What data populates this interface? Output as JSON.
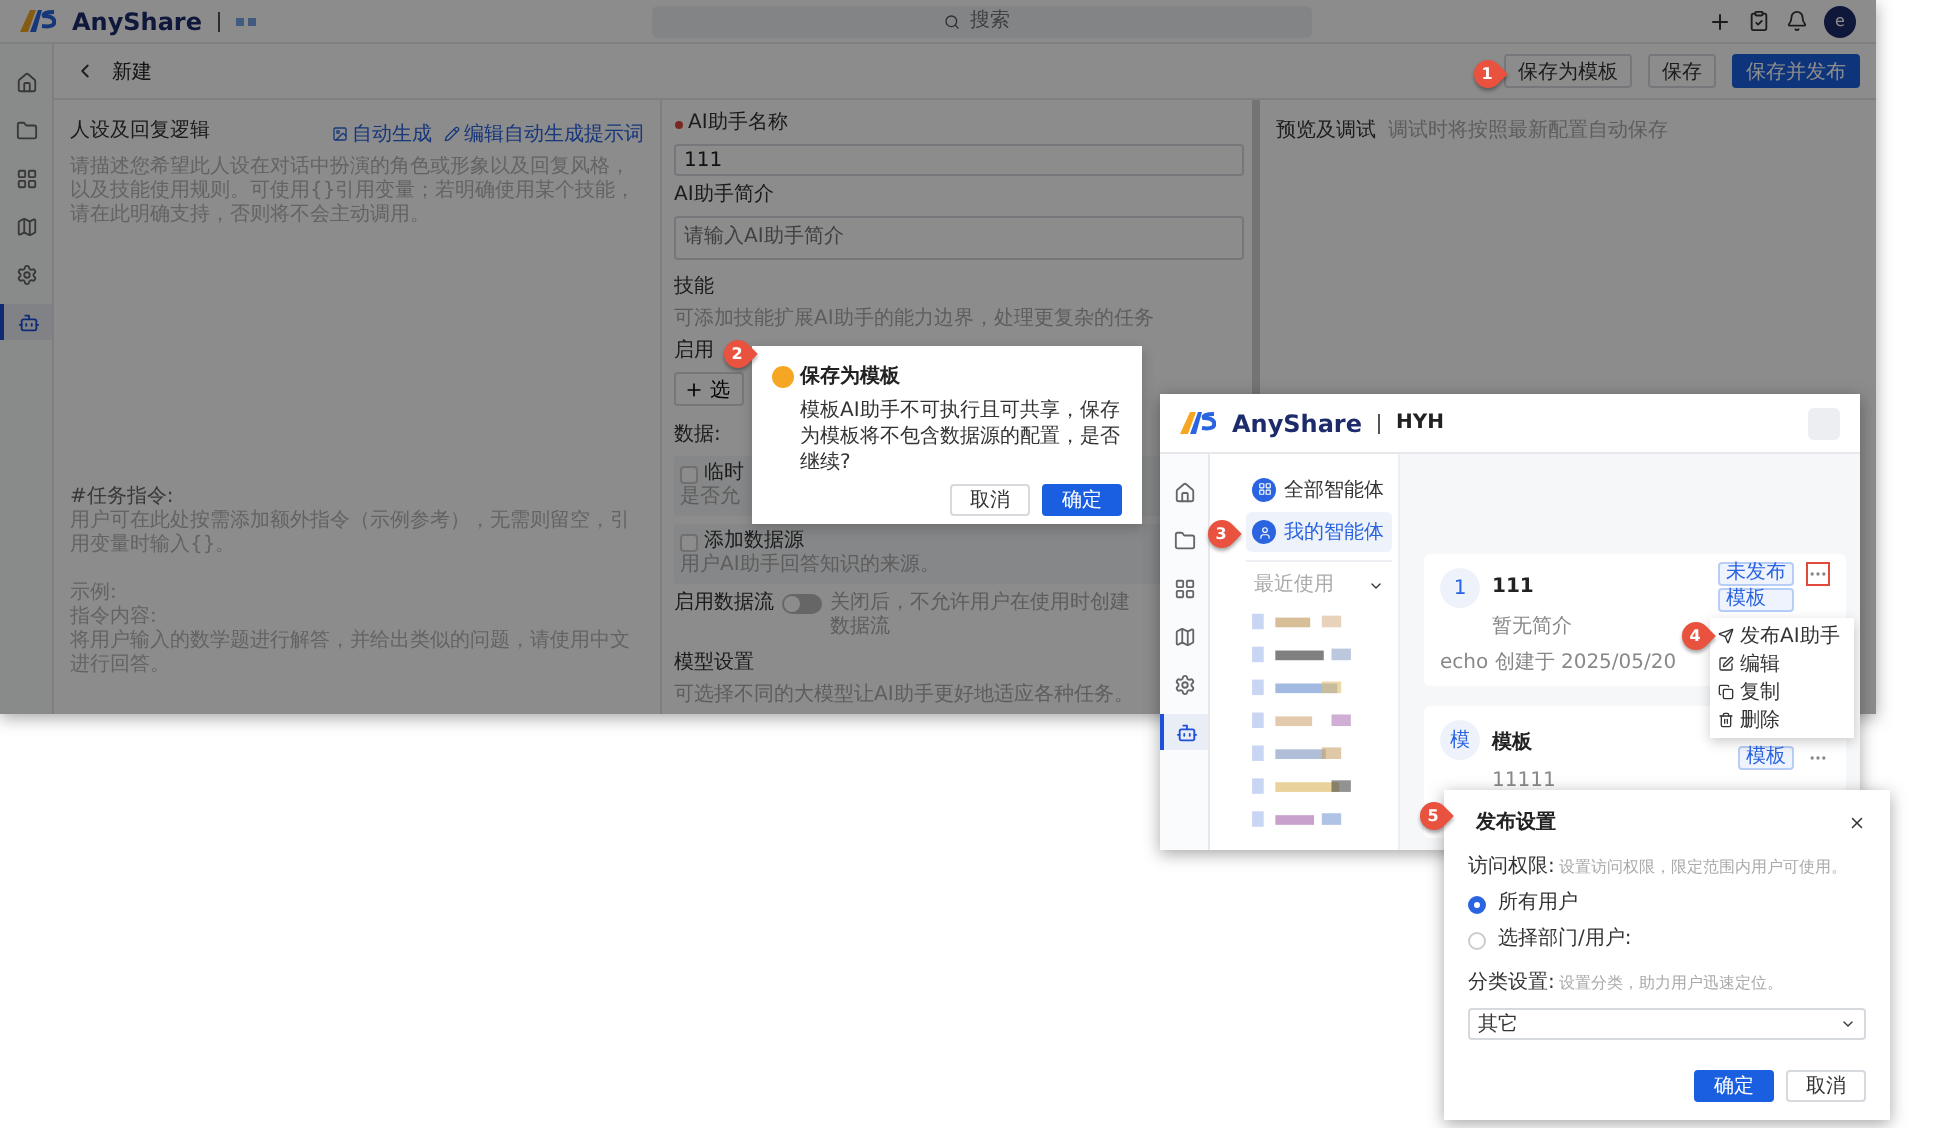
{
  "main_window": {
    "logo": "AnyShare",
    "search": {
      "placeholder": "搜索"
    },
    "avatar": "e",
    "rail": [
      {
        "selected": false
      },
      {
        "selected": false
      },
      {
        "selected": false
      },
      {
        "selected": false
      },
      {
        "selected": false
      },
      {
        "selected": true
      }
    ],
    "page_title": "新建",
    "header_buttons": [
      {
        "label": "保存为模板",
        "kind": "default"
      },
      {
        "label": "保存",
        "kind": "default"
      },
      {
        "label": "保存并发布",
        "kind": "primary"
      }
    ],
    "persona": {
      "title": "人设及回复逻辑",
      "links": [
        "自动生成",
        "编辑自动生成提示词"
      ],
      "placeholder": "请描述您希望此人设在对话中扮演的角色或形象以及回复风格，以及技能使用规则。可使用{}引用变量；若明确使用某个技能，请在此明确支持，否则将不会主动调用。",
      "instructions": [
        {
          "lines": [
            "#任务指令:",
            "用户可在此处按需添加额外指令（示例参考），无需则留空，引用变量时输入{}。"
          ]
        },
        {
          "lines": [
            "示例:",
            "指令内容:",
            "将用户输入的数学题进行解答，并给出类似的问题，请使用中文进行回答。"
          ]
        }
      ]
    },
    "form": {
      "name": {
        "label": "AI助手名称",
        "required": true,
        "value": "111"
      },
      "intro": {
        "label": "AI助手简介",
        "placeholder": "请输入AI助手简介"
      },
      "skills": {
        "title": "技能",
        "hint": "可添加技能扩展AI助手的能力边界，处理更复杂的任务",
        "enable_label": "启用",
        "add_button": "选"
      },
      "data": {
        "title": "数据:",
        "options": [
          {
            "label": "临时",
            "hint": "是否允",
            "checked": false
          },
          {
            "label": "添加数据源",
            "hint": "用户AI助手回答知识的来源。",
            "checked": false
          }
        ],
        "dataflow": {
          "label": "启用数据流",
          "on": false,
          "hint": "关闭后，不允许用户在使用时创建数据流"
        }
      },
      "model": {
        "title": "模型设置",
        "hint": "可选择不同的大模型让AI助手更好地适应各种任务。"
      }
    },
    "preview": {
      "title": "预览及调试",
      "hint": "调试时将按照最新配置自动保存"
    },
    "dialog": {
      "title": "保存为模板",
      "message": "模板AI助手不可执行且可共享，保存为模板将不包含数据源的配置，是否继续?",
      "buttons": [
        {
          "label": "取消",
          "kind": "default"
        },
        {
          "label": "确定",
          "kind": "primary"
        }
      ]
    }
  },
  "agents_window": {
    "logo": "AnyShare",
    "workspace": "HYH",
    "rail": [
      {
        "selected": false
      },
      {
        "selected": false
      },
      {
        "selected": false
      },
      {
        "selected": false
      },
      {
        "selected": false
      },
      {
        "selected": true
      }
    ],
    "nav": [
      {
        "label": "全部智能体",
        "selected": false
      },
      {
        "label": "我的智能体",
        "selected": true
      }
    ],
    "recent": {
      "title": "最近使用",
      "expanded": true
    },
    "cards": [
      {
        "avatar": "1",
        "title": "111",
        "description": "暂无简介",
        "tags": [
          "未发布",
          "模板"
        ],
        "footer": "echo 创建于 2025/05/20",
        "menu_highlighted": true
      },
      {
        "avatar": "模",
        "title": "模板",
        "description": "11111",
        "tags": [
          "模板"
        ],
        "menu_highlighted": false
      }
    ],
    "menu": [
      {
        "label": "发布AI助手"
      },
      {
        "label": "编辑"
      },
      {
        "label": "复制"
      },
      {
        "label": "删除"
      }
    ]
  },
  "publish_dialog": {
    "title": "发布设置",
    "access": {
      "label": "访问权限:",
      "hint": "设置访问权限，限定范围内用户可使用。",
      "options": [
        {
          "label": "所有用户",
          "selected": true
        },
        {
          "label": "选择部门/用户:",
          "selected": false
        }
      ]
    },
    "category": {
      "label": "分类设置:",
      "hint": "设置分类，助力用户迅速定位。",
      "value": "其它"
    },
    "buttons": [
      {
        "label": "确定",
        "kind": "primary"
      },
      {
        "label": "取消",
        "kind": "default"
      }
    ]
  },
  "steps": [
    "1",
    "2",
    "3",
    "4",
    "5"
  ]
}
